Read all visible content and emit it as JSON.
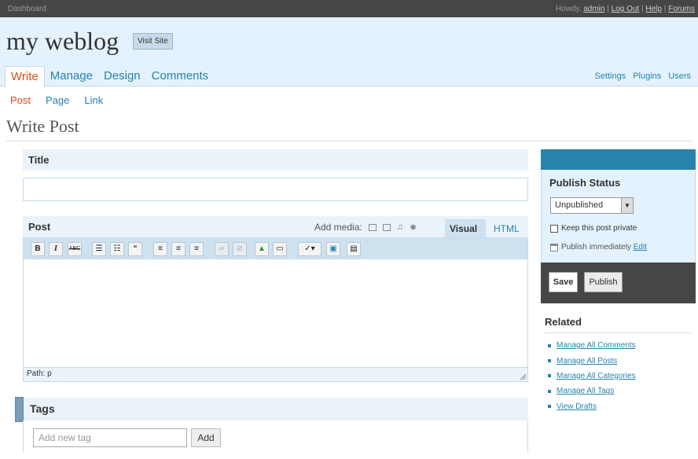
{
  "topbar": {
    "left": "Dashboard",
    "howdy": "Howdy,",
    "user": "admin",
    "logout": "Log Out",
    "help": "Help",
    "forums": "Forums"
  },
  "header": {
    "blog_name": "my weblog",
    "visit_site": "Visit Site",
    "main_menu": [
      "Write",
      "Manage",
      "Design",
      "Comments"
    ],
    "active_menu": "Write",
    "right_menu": [
      "Settings",
      "Plugins",
      "Users"
    ]
  },
  "submenu": [
    "Post",
    "Page",
    "Link"
  ],
  "page_title": "Write Post",
  "title_box": {
    "label": "Title",
    "value": ""
  },
  "post_box": {
    "label": "Post",
    "add_media": "Add media:",
    "tab_visual": "Visual",
    "tab_html": "HTML",
    "toolbar": {
      "bold": "B",
      "italic": "I",
      "strike": "ABC",
      "quote": "“"
    },
    "path": "Path: p"
  },
  "tags_box": {
    "label": "Tags",
    "placeholder": "Add new tag",
    "add_button": "Add"
  },
  "publish": {
    "heading": "Publish Status",
    "status": "Unpublished",
    "keep_private": "Keep this post private",
    "publish_when": "Publish immediately",
    "edit": "Edit",
    "save": "Save",
    "publish": "Publish",
    "accent_color": "#2583ad"
  },
  "related": {
    "heading": "Related",
    "links": [
      "Manage All Comments",
      "Manage All Posts",
      "Manage All Categories",
      "Manage All Tags",
      "View Drafts"
    ]
  }
}
